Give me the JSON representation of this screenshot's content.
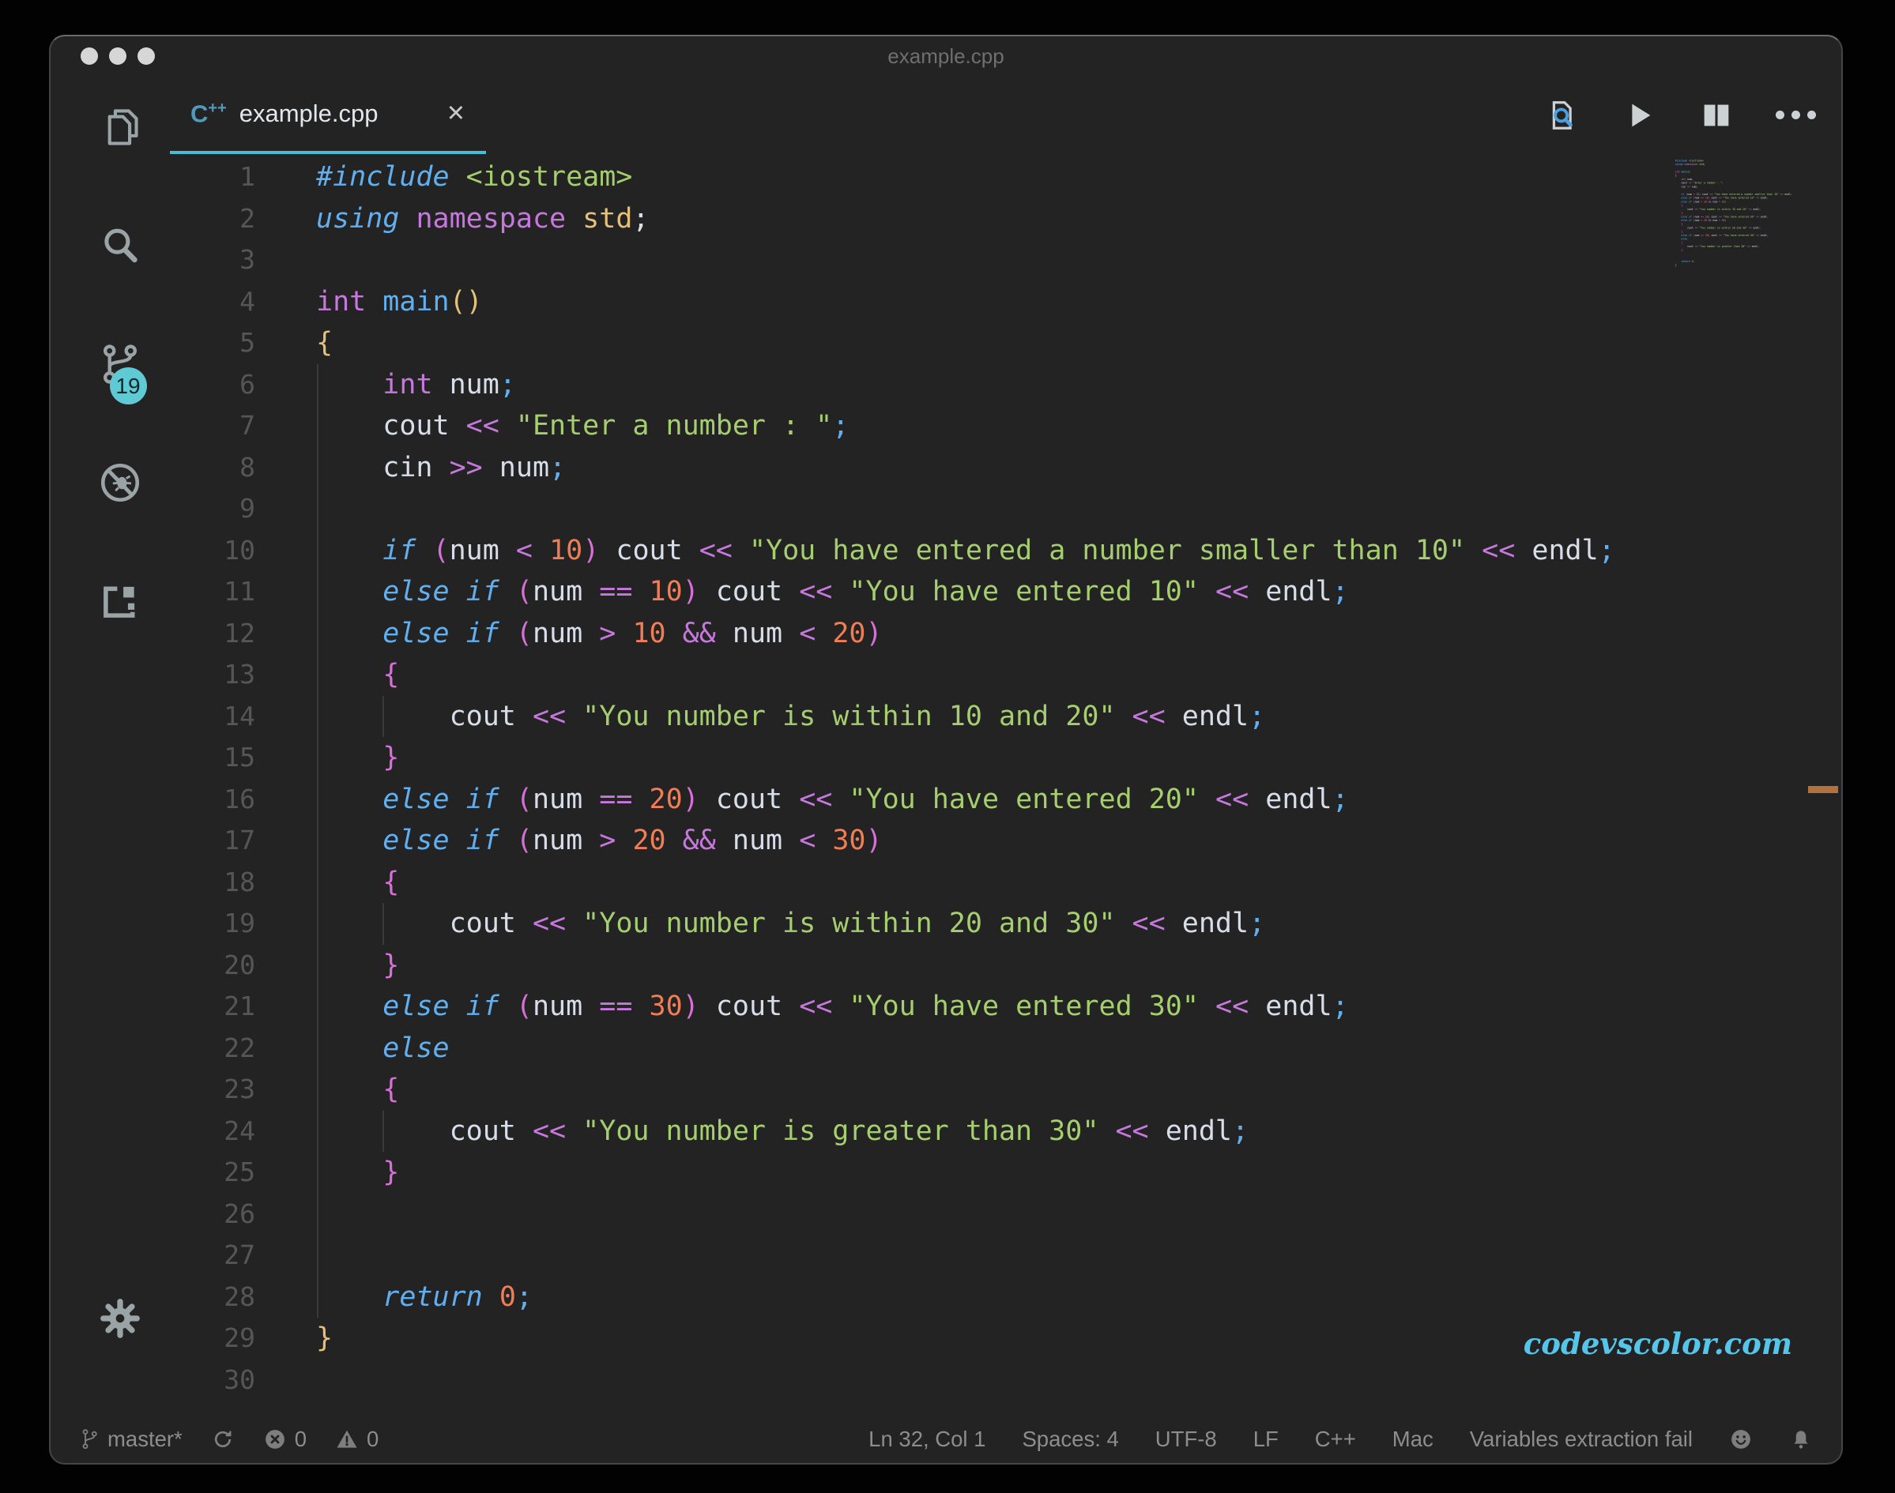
{
  "window": {
    "title": "example.cpp"
  },
  "tab": {
    "label": "example.cpp",
    "icon_text": "C",
    "icon_sup": "++",
    "close_glyph": "✕"
  },
  "activity_bar": {
    "scm_badge": "19"
  },
  "icons": {
    "titlebar": [
      "close",
      "minimize",
      "zoom"
    ],
    "activity": [
      "explorer-files",
      "search",
      "source-control",
      "debug-disabled",
      "extensions",
      "settings-gear"
    ],
    "editor_actions": [
      "search-in-file",
      "run",
      "split-editor",
      "more-actions"
    ],
    "tab": [
      "cpp-language",
      "close"
    ],
    "statusbar": [
      "git-branch",
      "sync",
      "error",
      "warning",
      "smiley",
      "bell"
    ]
  },
  "colors": {
    "ui": {
      "bg": "#232323",
      "accent": "#46bdd3",
      "badge": "#5fc9d4",
      "cpp": "#519aba",
      "marker": "#b5713c",
      "watermark": "#55c6ea"
    },
    "tokens": {
      "fg": "#d8dee9",
      "blue": "#61afef",
      "bluei": "#61afef",
      "purple": "#c678dd",
      "orchid": "#d670d6",
      "gold": "#e5c07b",
      "green": "#a5ce6e",
      "coral": "#ef7d56"
    }
  },
  "editor": {
    "watermark": "codevscolor.com",
    "lines": [
      [
        [
          "bluei",
          "#include"
        ],
        [
          "fg",
          " "
        ],
        [
          "green",
          "<iostream>"
        ]
      ],
      [
        [
          "bluei",
          "using"
        ],
        [
          "fg",
          " "
        ],
        [
          "purple",
          "namespace"
        ],
        [
          "fg",
          " "
        ],
        [
          "gold",
          "std"
        ],
        [
          "fg",
          ";"
        ]
      ],
      [],
      [
        [
          "purple",
          "int"
        ],
        [
          "fg",
          " "
        ],
        [
          "blue",
          "main"
        ],
        [
          "gold",
          "()"
        ]
      ],
      [
        [
          "gold",
          "{"
        ]
      ],
      [
        [
          "fg",
          "    "
        ],
        [
          "purple",
          "int"
        ],
        [
          "fg",
          " num"
        ],
        [
          "blue",
          ";"
        ]
      ],
      [
        [
          "fg",
          "    cout "
        ],
        [
          "purple",
          "<<"
        ],
        [
          "fg",
          " "
        ],
        [
          "green",
          "\"Enter a number : \""
        ],
        [
          "blue",
          ";"
        ]
      ],
      [
        [
          "fg",
          "    cin "
        ],
        [
          "purple",
          ">>"
        ],
        [
          "fg",
          " num"
        ],
        [
          "blue",
          ";"
        ]
      ],
      [],
      [
        [
          "fg",
          "    "
        ],
        [
          "bluei",
          "if"
        ],
        [
          "fg",
          " "
        ],
        [
          "orchid",
          "("
        ],
        [
          "fg",
          "num "
        ],
        [
          "purple",
          "<"
        ],
        [
          "fg",
          " "
        ],
        [
          "coral",
          "10"
        ],
        [
          "orchid",
          ")"
        ],
        [
          "fg",
          " cout "
        ],
        [
          "purple",
          "<<"
        ],
        [
          "fg",
          " "
        ],
        [
          "green",
          "\"You have entered a number smaller than 10\""
        ],
        [
          "fg",
          " "
        ],
        [
          "purple",
          "<<"
        ],
        [
          "fg",
          " endl"
        ],
        [
          "blue",
          ";"
        ]
      ],
      [
        [
          "fg",
          "    "
        ],
        [
          "bluei",
          "else"
        ],
        [
          "fg",
          " "
        ],
        [
          "bluei",
          "if"
        ],
        [
          "fg",
          " "
        ],
        [
          "orchid",
          "("
        ],
        [
          "fg",
          "num "
        ],
        [
          "purple",
          "=="
        ],
        [
          "fg",
          " "
        ],
        [
          "coral",
          "10"
        ],
        [
          "orchid",
          ")"
        ],
        [
          "fg",
          " cout "
        ],
        [
          "purple",
          "<<"
        ],
        [
          "fg",
          " "
        ],
        [
          "green",
          "\"You have entered 10\""
        ],
        [
          "fg",
          " "
        ],
        [
          "purple",
          "<<"
        ],
        [
          "fg",
          " endl"
        ],
        [
          "blue",
          ";"
        ]
      ],
      [
        [
          "fg",
          "    "
        ],
        [
          "bluei",
          "else"
        ],
        [
          "fg",
          " "
        ],
        [
          "bluei",
          "if"
        ],
        [
          "fg",
          " "
        ],
        [
          "orchid",
          "("
        ],
        [
          "fg",
          "num "
        ],
        [
          "purple",
          ">"
        ],
        [
          "fg",
          " "
        ],
        [
          "coral",
          "10"
        ],
        [
          "fg",
          " "
        ],
        [
          "purple",
          "&&"
        ],
        [
          "fg",
          " num "
        ],
        [
          "purple",
          "<"
        ],
        [
          "fg",
          " "
        ],
        [
          "coral",
          "20"
        ],
        [
          "orchid",
          ")"
        ]
      ],
      [
        [
          "fg",
          "    "
        ],
        [
          "orchid",
          "{"
        ]
      ],
      [
        [
          "fg",
          "        cout "
        ],
        [
          "purple",
          "<<"
        ],
        [
          "fg",
          " "
        ],
        [
          "green",
          "\"You number is within 10 and 20\""
        ],
        [
          "fg",
          " "
        ],
        [
          "purple",
          "<<"
        ],
        [
          "fg",
          " endl"
        ],
        [
          "blue",
          ";"
        ]
      ],
      [
        [
          "fg",
          "    "
        ],
        [
          "orchid",
          "}"
        ]
      ],
      [
        [
          "fg",
          "    "
        ],
        [
          "bluei",
          "else"
        ],
        [
          "fg",
          " "
        ],
        [
          "bluei",
          "if"
        ],
        [
          "fg",
          " "
        ],
        [
          "orchid",
          "("
        ],
        [
          "fg",
          "num "
        ],
        [
          "purple",
          "=="
        ],
        [
          "fg",
          " "
        ],
        [
          "coral",
          "20"
        ],
        [
          "orchid",
          ")"
        ],
        [
          "fg",
          " cout "
        ],
        [
          "purple",
          "<<"
        ],
        [
          "fg",
          " "
        ],
        [
          "green",
          "\"You have entered 20\""
        ],
        [
          "fg",
          " "
        ],
        [
          "purple",
          "<<"
        ],
        [
          "fg",
          " endl"
        ],
        [
          "blue",
          ";"
        ]
      ],
      [
        [
          "fg",
          "    "
        ],
        [
          "bluei",
          "else"
        ],
        [
          "fg",
          " "
        ],
        [
          "bluei",
          "if"
        ],
        [
          "fg",
          " "
        ],
        [
          "orchid",
          "("
        ],
        [
          "fg",
          "num "
        ],
        [
          "purple",
          ">"
        ],
        [
          "fg",
          " "
        ],
        [
          "coral",
          "20"
        ],
        [
          "fg",
          " "
        ],
        [
          "purple",
          "&&"
        ],
        [
          "fg",
          " num "
        ],
        [
          "purple",
          "<"
        ],
        [
          "fg",
          " "
        ],
        [
          "coral",
          "30"
        ],
        [
          "orchid",
          ")"
        ]
      ],
      [
        [
          "fg",
          "    "
        ],
        [
          "orchid",
          "{"
        ]
      ],
      [
        [
          "fg",
          "        cout "
        ],
        [
          "purple",
          "<<"
        ],
        [
          "fg",
          " "
        ],
        [
          "green",
          "\"You number is within 20 and 30\""
        ],
        [
          "fg",
          " "
        ],
        [
          "purple",
          "<<"
        ],
        [
          "fg",
          " endl"
        ],
        [
          "blue",
          ";"
        ]
      ],
      [
        [
          "fg",
          "    "
        ],
        [
          "orchid",
          "}"
        ]
      ],
      [
        [
          "fg",
          "    "
        ],
        [
          "bluei",
          "else"
        ],
        [
          "fg",
          " "
        ],
        [
          "bluei",
          "if"
        ],
        [
          "fg",
          " "
        ],
        [
          "orchid",
          "("
        ],
        [
          "fg",
          "num "
        ],
        [
          "purple",
          "=="
        ],
        [
          "fg",
          " "
        ],
        [
          "coral",
          "30"
        ],
        [
          "orchid",
          ")"
        ],
        [
          "fg",
          " cout "
        ],
        [
          "purple",
          "<<"
        ],
        [
          "fg",
          " "
        ],
        [
          "green",
          "\"You have entered 30\""
        ],
        [
          "fg",
          " "
        ],
        [
          "purple",
          "<<"
        ],
        [
          "fg",
          " endl"
        ],
        [
          "blue",
          ";"
        ]
      ],
      [
        [
          "fg",
          "    "
        ],
        [
          "bluei",
          "else"
        ]
      ],
      [
        [
          "fg",
          "    "
        ],
        [
          "orchid",
          "{"
        ]
      ],
      [
        [
          "fg",
          "        cout "
        ],
        [
          "purple",
          "<<"
        ],
        [
          "fg",
          " "
        ],
        [
          "green",
          "\"You number is greater than 30\""
        ],
        [
          "fg",
          " "
        ],
        [
          "purple",
          "<<"
        ],
        [
          "fg",
          " endl"
        ],
        [
          "blue",
          ";"
        ]
      ],
      [
        [
          "fg",
          "    "
        ],
        [
          "orchid",
          "}"
        ]
      ],
      [],
      [],
      [
        [
          "fg",
          "    "
        ],
        [
          "bluei",
          "return"
        ],
        [
          "fg",
          " "
        ],
        [
          "coral",
          "0"
        ],
        [
          "blue",
          ";"
        ]
      ],
      [
        [
          "gold",
          "}"
        ]
      ],
      []
    ]
  },
  "statusbar": {
    "branch": "master*",
    "errors": "0",
    "warnings": "0",
    "position": "Ln 32, Col 1",
    "spaces": "Spaces: 4",
    "encoding": "UTF-8",
    "eol": "LF",
    "language": "C++",
    "platform": "Mac",
    "message": "Variables extraction fail"
  }
}
